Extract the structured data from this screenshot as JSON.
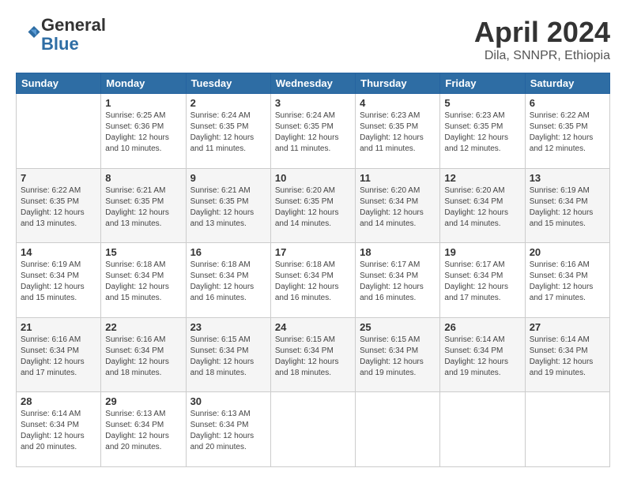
{
  "header": {
    "logo": {
      "line1": "General",
      "line2": "Blue"
    },
    "title": "April 2024",
    "subtitle": "Dila, SNNPR, Ethiopia"
  },
  "columns": [
    "Sunday",
    "Monday",
    "Tuesday",
    "Wednesday",
    "Thursday",
    "Friday",
    "Saturday"
  ],
  "weeks": [
    [
      {
        "day": "",
        "info": ""
      },
      {
        "day": "1",
        "info": "Sunrise: 6:25 AM\nSunset: 6:36 PM\nDaylight: 12 hours\nand 10 minutes."
      },
      {
        "day": "2",
        "info": "Sunrise: 6:24 AM\nSunset: 6:35 PM\nDaylight: 12 hours\nand 11 minutes."
      },
      {
        "day": "3",
        "info": "Sunrise: 6:24 AM\nSunset: 6:35 PM\nDaylight: 12 hours\nand 11 minutes."
      },
      {
        "day": "4",
        "info": "Sunrise: 6:23 AM\nSunset: 6:35 PM\nDaylight: 12 hours\nand 11 minutes."
      },
      {
        "day": "5",
        "info": "Sunrise: 6:23 AM\nSunset: 6:35 PM\nDaylight: 12 hours\nand 12 minutes."
      },
      {
        "day": "6",
        "info": "Sunrise: 6:22 AM\nSunset: 6:35 PM\nDaylight: 12 hours\nand 12 minutes."
      }
    ],
    [
      {
        "day": "7",
        "info": "Sunrise: 6:22 AM\nSunset: 6:35 PM\nDaylight: 12 hours\nand 13 minutes."
      },
      {
        "day": "8",
        "info": "Sunrise: 6:21 AM\nSunset: 6:35 PM\nDaylight: 12 hours\nand 13 minutes."
      },
      {
        "day": "9",
        "info": "Sunrise: 6:21 AM\nSunset: 6:35 PM\nDaylight: 12 hours\nand 13 minutes."
      },
      {
        "day": "10",
        "info": "Sunrise: 6:20 AM\nSunset: 6:35 PM\nDaylight: 12 hours\nand 14 minutes."
      },
      {
        "day": "11",
        "info": "Sunrise: 6:20 AM\nSunset: 6:34 PM\nDaylight: 12 hours\nand 14 minutes."
      },
      {
        "day": "12",
        "info": "Sunrise: 6:20 AM\nSunset: 6:34 PM\nDaylight: 12 hours\nand 14 minutes."
      },
      {
        "day": "13",
        "info": "Sunrise: 6:19 AM\nSunset: 6:34 PM\nDaylight: 12 hours\nand 15 minutes."
      }
    ],
    [
      {
        "day": "14",
        "info": "Sunrise: 6:19 AM\nSunset: 6:34 PM\nDaylight: 12 hours\nand 15 minutes."
      },
      {
        "day": "15",
        "info": "Sunrise: 6:18 AM\nSunset: 6:34 PM\nDaylight: 12 hours\nand 15 minutes."
      },
      {
        "day": "16",
        "info": "Sunrise: 6:18 AM\nSunset: 6:34 PM\nDaylight: 12 hours\nand 16 minutes."
      },
      {
        "day": "17",
        "info": "Sunrise: 6:18 AM\nSunset: 6:34 PM\nDaylight: 12 hours\nand 16 minutes."
      },
      {
        "day": "18",
        "info": "Sunrise: 6:17 AM\nSunset: 6:34 PM\nDaylight: 12 hours\nand 16 minutes."
      },
      {
        "day": "19",
        "info": "Sunrise: 6:17 AM\nSunset: 6:34 PM\nDaylight: 12 hours\nand 17 minutes."
      },
      {
        "day": "20",
        "info": "Sunrise: 6:16 AM\nSunset: 6:34 PM\nDaylight: 12 hours\nand 17 minutes."
      }
    ],
    [
      {
        "day": "21",
        "info": "Sunrise: 6:16 AM\nSunset: 6:34 PM\nDaylight: 12 hours\nand 17 minutes."
      },
      {
        "day": "22",
        "info": "Sunrise: 6:16 AM\nSunset: 6:34 PM\nDaylight: 12 hours\nand 18 minutes."
      },
      {
        "day": "23",
        "info": "Sunrise: 6:15 AM\nSunset: 6:34 PM\nDaylight: 12 hours\nand 18 minutes."
      },
      {
        "day": "24",
        "info": "Sunrise: 6:15 AM\nSunset: 6:34 PM\nDaylight: 12 hours\nand 18 minutes."
      },
      {
        "day": "25",
        "info": "Sunrise: 6:15 AM\nSunset: 6:34 PM\nDaylight: 12 hours\nand 19 minutes."
      },
      {
        "day": "26",
        "info": "Sunrise: 6:14 AM\nSunset: 6:34 PM\nDaylight: 12 hours\nand 19 minutes."
      },
      {
        "day": "27",
        "info": "Sunrise: 6:14 AM\nSunset: 6:34 PM\nDaylight: 12 hours\nand 19 minutes."
      }
    ],
    [
      {
        "day": "28",
        "info": "Sunrise: 6:14 AM\nSunset: 6:34 PM\nDaylight: 12 hours\nand 20 minutes."
      },
      {
        "day": "29",
        "info": "Sunrise: 6:13 AM\nSunset: 6:34 PM\nDaylight: 12 hours\nand 20 minutes."
      },
      {
        "day": "30",
        "info": "Sunrise: 6:13 AM\nSunset: 6:34 PM\nDaylight: 12 hours\nand 20 minutes."
      },
      {
        "day": "",
        "info": ""
      },
      {
        "day": "",
        "info": ""
      },
      {
        "day": "",
        "info": ""
      },
      {
        "day": "",
        "info": ""
      }
    ]
  ]
}
